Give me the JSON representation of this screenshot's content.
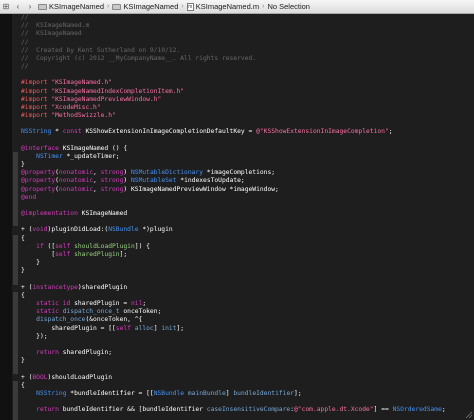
{
  "jumpbar": {
    "items": [
      {
        "name": "jumpbar-project",
        "icon": "folder",
        "label": "KSImageNamed"
      },
      {
        "name": "jumpbar-group",
        "icon": "folder",
        "label": "KSImageNamed"
      },
      {
        "name": "jumpbar-file",
        "icon": "mfile",
        "label": "KSImageNamed.m"
      },
      {
        "name": "jumpbar-selection",
        "icon": "none",
        "label": "No Selection"
      }
    ]
  },
  "code_lines": [
    [
      [
        "c",
        "//"
      ]
    ],
    [
      [
        "c",
        "//  KSImageNamed.m"
      ]
    ],
    [
      [
        "c",
        "//  KSImageNamed"
      ]
    ],
    [
      [
        "c",
        "//"
      ]
    ],
    [
      [
        "c",
        "//  Created by Kent Sutherland on 9/10/12."
      ]
    ],
    [
      [
        "c",
        "//  Copyright (c) 2012 __MyCompanyName__. All rights reserved."
      ]
    ],
    [
      [
        "c",
        "//"
      ]
    ],
    [],
    [
      [
        "p",
        "#import "
      ],
      [
        "s",
        "\"KSImageNamed.h\""
      ]
    ],
    [
      [
        "p",
        "#import "
      ],
      [
        "s",
        "\"KSImageNamedIndexCompletionItem.h\""
      ]
    ],
    [
      [
        "p",
        "#import "
      ],
      [
        "s",
        "\"KSImageNamedPreviewWindow.h\""
      ]
    ],
    [
      [
        "p",
        "#import "
      ],
      [
        "s",
        "\"XcodeMisc.h\""
      ]
    ],
    [
      [
        "p",
        "#import "
      ],
      [
        "s",
        "\"MethodSwizzle.h\""
      ]
    ],
    [],
    [
      [
        "t",
        "NSString"
      ],
      [
        "w",
        " * "
      ],
      [
        "k",
        "const"
      ],
      [
        "w",
        " KSShowExtensionInImageCompletionDefaultKey = "
      ],
      [
        "s",
        "@\"KSShowExtensionInImageCompletion\""
      ],
      [
        "w",
        ";"
      ]
    ],
    [],
    [
      [
        "k",
        "@interface"
      ],
      [
        "w",
        " KSImageNamed () {"
      ]
    ],
    [
      [
        "w",
        "    "
      ],
      [
        "t",
        "NSTimer"
      ],
      [
        "w",
        " *_updateTimer;"
      ]
    ],
    [
      [
        "w",
        "}"
      ]
    ],
    [
      [
        "k",
        "@property"
      ],
      [
        "w",
        "("
      ],
      [
        "k",
        "nonatomic"
      ],
      [
        "w",
        ", "
      ],
      [
        "k",
        "strong"
      ],
      [
        "w",
        ") "
      ],
      [
        "t",
        "NSMutableDictionary"
      ],
      [
        "w",
        " *imageCompletions;"
      ]
    ],
    [
      [
        "k",
        "@property"
      ],
      [
        "w",
        "("
      ],
      [
        "k",
        "nonatomic"
      ],
      [
        "w",
        ", "
      ],
      [
        "k",
        "strong"
      ],
      [
        "w",
        ") "
      ],
      [
        "t",
        "NSMutableSet"
      ],
      [
        "w",
        " *indexesToUpdate;"
      ]
    ],
    [
      [
        "k",
        "@property"
      ],
      [
        "w",
        "("
      ],
      [
        "k",
        "nonatomic"
      ],
      [
        "w",
        ", "
      ],
      [
        "k",
        "strong"
      ],
      [
        "w",
        ") KSImageNamedPreviewWindow *imageWindow;"
      ]
    ],
    [
      [
        "k",
        "@end"
      ]
    ],
    [],
    [
      [
        "k",
        "@implementation"
      ],
      [
        "w",
        " KSImageNamed"
      ]
    ],
    [],
    [
      [
        "w",
        "+ ("
      ],
      [
        "k",
        "void"
      ],
      [
        "w",
        ")pluginDidLoad:("
      ],
      [
        "t",
        "NSBundle"
      ],
      [
        "w",
        " *)plugin"
      ]
    ],
    [
      [
        "w",
        "{"
      ]
    ],
    [
      [
        "w",
        "    "
      ],
      [
        "k",
        "if"
      ],
      [
        "w",
        " (["
      ],
      [
        "k",
        "self"
      ],
      [
        "w",
        " "
      ],
      [
        "n",
        "shouldLoadPlugin"
      ],
      [
        "w",
        "]) {"
      ]
    ],
    [
      [
        "w",
        "        ["
      ],
      [
        "k",
        "self"
      ],
      [
        "w",
        " "
      ],
      [
        "n",
        "sharedPlugin"
      ],
      [
        "w",
        "];"
      ]
    ],
    [
      [
        "w",
        "    }"
      ]
    ],
    [
      [
        "w",
        "}"
      ]
    ],
    [],
    [
      [
        "w",
        "+ ("
      ],
      [
        "k",
        "instancetype"
      ],
      [
        "w",
        ")sharedPlugin"
      ]
    ],
    [
      [
        "w",
        "{"
      ]
    ],
    [
      [
        "w",
        "    "
      ],
      [
        "k",
        "static"
      ],
      [
        "w",
        " "
      ],
      [
        "k",
        "id"
      ],
      [
        "w",
        " sharedPlugin = "
      ],
      [
        "k",
        "nil"
      ],
      [
        "w",
        ";"
      ]
    ],
    [
      [
        "w",
        "    "
      ],
      [
        "k",
        "static"
      ],
      [
        "w",
        " "
      ],
      [
        "m",
        "dispatch_once_t"
      ],
      [
        "w",
        " onceToken;"
      ]
    ],
    [
      [
        "w",
        "    "
      ],
      [
        "m",
        "dispatch_once"
      ],
      [
        "w",
        "(&onceToken, ^{"
      ]
    ],
    [
      [
        "w",
        "        sharedPlugin = [["
      ],
      [
        "k",
        "self"
      ],
      [
        "w",
        " "
      ],
      [
        "m",
        "alloc"
      ],
      [
        "w",
        "] "
      ],
      [
        "m",
        "init"
      ],
      [
        "w",
        "];"
      ]
    ],
    [
      [
        "w",
        "    });"
      ]
    ],
    [],
    [
      [
        "w",
        "    "
      ],
      [
        "k",
        "return"
      ],
      [
        "w",
        " sharedPlugin;"
      ]
    ],
    [
      [
        "w",
        "}"
      ]
    ],
    [],
    [
      [
        "w",
        "+ ("
      ],
      [
        "k",
        "BOOL"
      ],
      [
        "w",
        ")shouldLoadPlugin"
      ]
    ],
    [
      [
        "w",
        "{"
      ]
    ],
    [
      [
        "w",
        "    "
      ],
      [
        "t",
        "NSString"
      ],
      [
        "w",
        " *bundleIdentifier = [["
      ],
      [
        "t",
        "NSBundle"
      ],
      [
        "w",
        " "
      ],
      [
        "m",
        "mainBundle"
      ],
      [
        "w",
        "] "
      ],
      [
        "m",
        "bundleIdentifier"
      ],
      [
        "w",
        "];"
      ]
    ],
    [],
    [
      [
        "w",
        "    "
      ],
      [
        "k",
        "return"
      ],
      [
        "w",
        " bundleIdentifier && [bundleIdentifier "
      ],
      [
        "m",
        "caseInsensitiveCompare"
      ],
      [
        "w",
        ":"
      ],
      [
        "s",
        "@\"com.apple.dt.Xcode\""
      ],
      [
        "w",
        "] == "
      ],
      [
        "t",
        "NSOrderedSame"
      ],
      [
        "w",
        ";"
      ]
    ]
  ]
}
